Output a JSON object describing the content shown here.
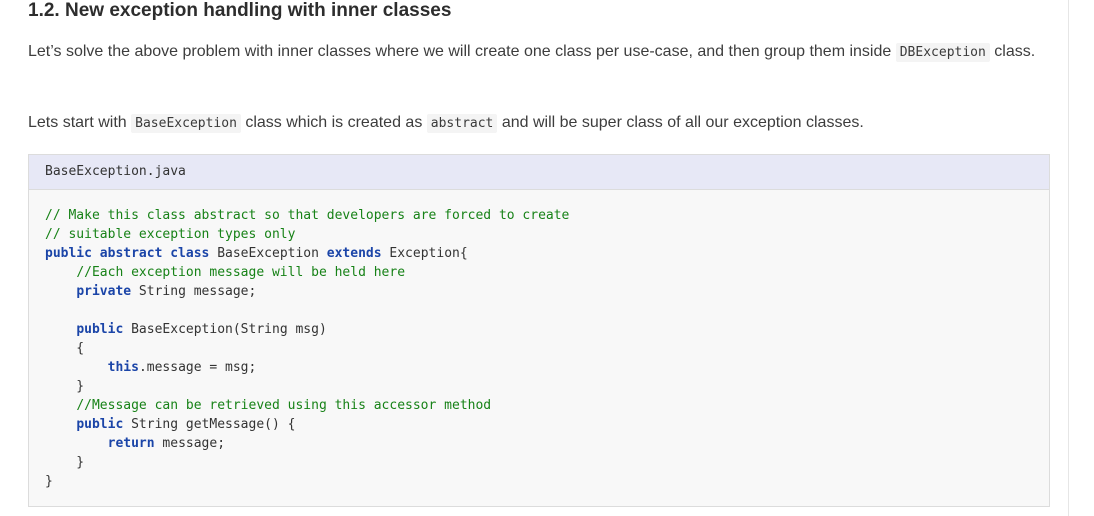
{
  "heading": "1.2. New exception handling with inner classes",
  "para1": {
    "text_before": "Let’s solve the above problem with inner classes where we will create one class per use-case, and then group them inside ",
    "code": "DBException",
    "text_after": " class."
  },
  "para2": {
    "text_before": "Lets start with ",
    "code1": "BaseException",
    "text_mid": " class which is created as ",
    "code2": "abstract",
    "text_after": " and will be super class of all our exception classes."
  },
  "code_block": {
    "filename": "BaseException.java",
    "lines": [
      [
        {
          "t": "cm",
          "v": "// Make this class abstract so that developers are forced to create"
        }
      ],
      [
        {
          "t": "cm",
          "v": "// suitable exception types only"
        }
      ],
      [
        {
          "t": "kw",
          "v": "public abstract class"
        },
        {
          "t": "pl",
          "v": " BaseException "
        },
        {
          "t": "kw",
          "v": "extends"
        },
        {
          "t": "pl",
          "v": " Exception{"
        }
      ],
      [
        {
          "t": "pl",
          "v": "    "
        },
        {
          "t": "cm",
          "v": "//Each exception message will be held here"
        }
      ],
      [
        {
          "t": "pl",
          "v": "    "
        },
        {
          "t": "kw",
          "v": "private"
        },
        {
          "t": "pl",
          "v": " String message;"
        }
      ],
      [
        {
          "t": "pl",
          "v": ""
        }
      ],
      [
        {
          "t": "pl",
          "v": "    "
        },
        {
          "t": "kw",
          "v": "public"
        },
        {
          "t": "pl",
          "v": " BaseException(String msg)"
        }
      ],
      [
        {
          "t": "pl",
          "v": "    {"
        }
      ],
      [
        {
          "t": "pl",
          "v": "        "
        },
        {
          "t": "kw",
          "v": "this"
        },
        {
          "t": "pl",
          "v": ".message = msg;"
        }
      ],
      [
        {
          "t": "pl",
          "v": "    }"
        }
      ],
      [
        {
          "t": "pl",
          "v": "    "
        },
        {
          "t": "cm",
          "v": "//Message can be retrieved using this accessor method"
        }
      ],
      [
        {
          "t": "pl",
          "v": "    "
        },
        {
          "t": "kw",
          "v": "public"
        },
        {
          "t": "pl",
          "v": " String getMessage() {"
        }
      ],
      [
        {
          "t": "pl",
          "v": "        "
        },
        {
          "t": "kw",
          "v": "return"
        },
        {
          "t": "pl",
          "v": " message;"
        }
      ],
      [
        {
          "t": "pl",
          "v": "    }"
        }
      ],
      [
        {
          "t": "pl",
          "v": "}"
        }
      ]
    ]
  }
}
